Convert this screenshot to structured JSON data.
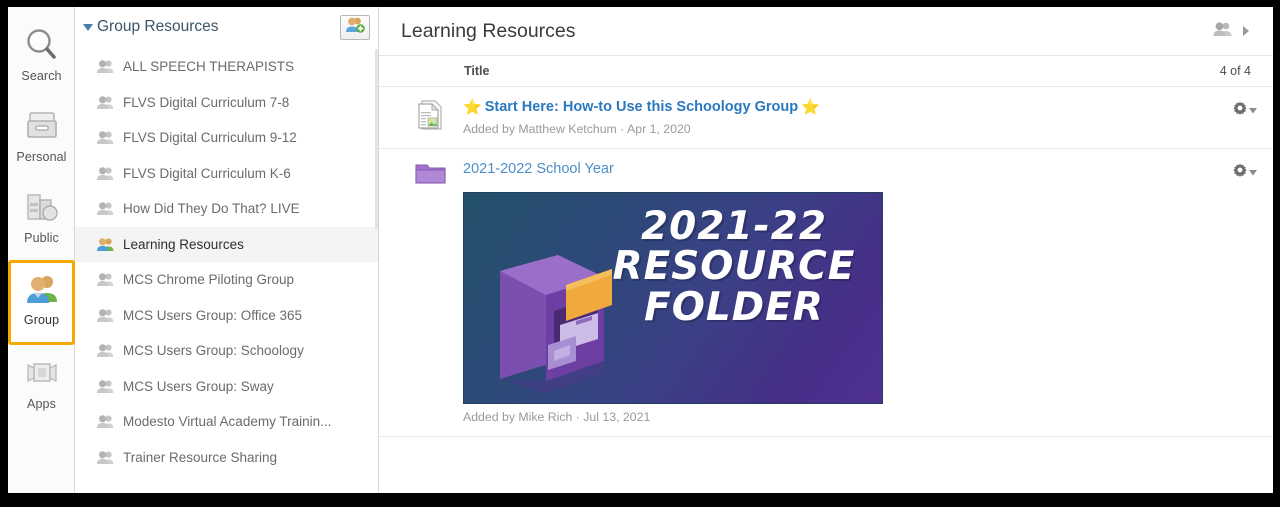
{
  "rail": {
    "items": [
      {
        "label": "Search",
        "icon": "search-icon",
        "selected": false
      },
      {
        "label": "Personal",
        "icon": "personal-archive-icon",
        "selected": false
      },
      {
        "label": "Public",
        "icon": "public-buildings-icon",
        "selected": false
      },
      {
        "label": "Group",
        "icon": "group-people-icon",
        "selected": true
      },
      {
        "label": "Apps",
        "icon": "apps-icon",
        "selected": false
      }
    ],
    "selection_color": "#f5a800"
  },
  "group_panel": {
    "header": "Group Resources",
    "caret_icon": "caret-down-icon",
    "add_button_icon": "add-group-icon",
    "items": [
      {
        "label": "ALL SPEECH THERAPISTS",
        "active": false
      },
      {
        "label": "FLVS Digital Curriculum 7-8",
        "active": false
      },
      {
        "label": "FLVS Digital Curriculum 9-12",
        "active": false
      },
      {
        "label": "FLVS Digital Curriculum K-6",
        "active": false
      },
      {
        "label": "How Did They Do That? LIVE",
        "active": false
      },
      {
        "label": "Learning Resources",
        "active": true
      },
      {
        "label": "MCS Chrome Piloting Group",
        "active": false
      },
      {
        "label": "MCS Users Group: Office 365",
        "active": false
      },
      {
        "label": "MCS Users Group: Schoology",
        "active": false
      },
      {
        "label": "MCS Users Group: Sway",
        "active": false
      },
      {
        "label": "Modesto Virtual Academy Trainin...",
        "active": false
      },
      {
        "label": "Trainer Resource Sharing",
        "active": false
      }
    ]
  },
  "main": {
    "title": "Learning Resources",
    "header_group_icon": "group-people-icon",
    "header_arrow_icon": "chevron-right-icon",
    "column_title": "Title",
    "count": "4 of 4",
    "rows": [
      {
        "icon": "document-page-icon",
        "star_left": "⭐",
        "title": "Start Here: How-to Use this Schoology Group",
        "star_right": "⭐",
        "subtitle": "Added by Matthew Ketchum · Apr 1, 2020",
        "gear_icon": "gear-icon",
        "gear_caret": "caret-down-icon",
        "link_color": "#2a79c0"
      },
      {
        "icon": "folder-icon",
        "title": "2021-2022 School Year",
        "subtitle": "Added by Mike Rich · Jul 13, 2021",
        "gear_icon": "gear-icon",
        "gear_caret": "caret-down-icon",
        "link_color": "#4e8ec9",
        "banner": {
          "line1": "2021-22",
          "line2": "RESOURCE",
          "line3": "FOLDER",
          "gradient_from": "#22506b",
          "gradient_to": "#503093",
          "illustration": "filing-cabinet-icon",
          "cabinet_light": "#9b6fc9",
          "cabinet_mid": "#7b4fb0",
          "cabinet_dark": "#5d3a8f",
          "folder_accent": "#f0a93c"
        }
      }
    ]
  }
}
